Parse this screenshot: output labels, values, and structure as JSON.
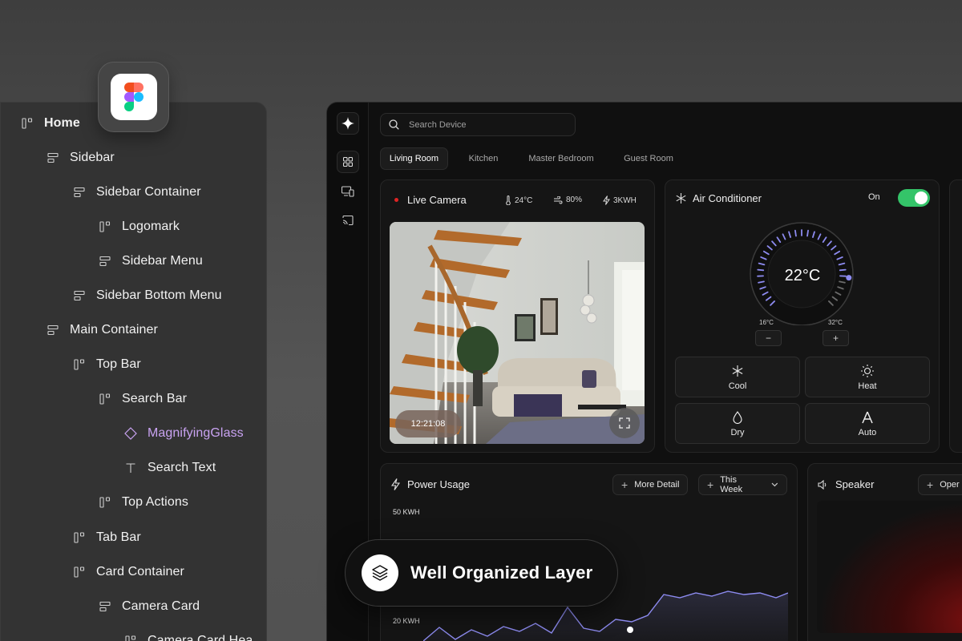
{
  "layers": [
    {
      "label": "Home",
      "icon": "frame-icon",
      "level": 0,
      "bold": true
    },
    {
      "label": "Sidebar",
      "icon": "auto-layout-icon",
      "level": 1
    },
    {
      "label": "Sidebar Container",
      "icon": "auto-layout-icon",
      "level": 2
    },
    {
      "label": "Logomark",
      "icon": "frame-icon",
      "level": 3
    },
    {
      "label": "Sidebar Menu",
      "icon": "auto-layout-icon",
      "level": 3
    },
    {
      "label": "Sidebar Bottom Menu",
      "icon": "auto-layout-icon",
      "level": 2
    },
    {
      "label": "Main Container",
      "icon": "auto-layout-icon",
      "level": 1
    },
    {
      "label": "Top Bar",
      "icon": "frame-icon",
      "level": 2
    },
    {
      "label": "Search Bar",
      "icon": "frame-icon",
      "level": 3
    },
    {
      "label": "MagnifyingGlass",
      "icon": "component-icon",
      "level": 4,
      "purple": true
    },
    {
      "label": "Search Text",
      "icon": "text-icon",
      "level": 4
    },
    {
      "label": "Top Actions",
      "icon": "frame-icon",
      "level": 3
    },
    {
      "label": "Tab Bar",
      "icon": "frame-icon",
      "level": 2
    },
    {
      "label": "Card Container",
      "icon": "frame-icon",
      "level": 2
    },
    {
      "label": "Camera Card",
      "icon": "auto-layout-icon",
      "level": 3
    },
    {
      "label": "Camera Card Hea",
      "icon": "frame-icon",
      "level": 4
    }
  ],
  "search": {
    "placeholder": "Search Device"
  },
  "tabs": [
    "Living Room",
    "Kitchen",
    "Master Bedroom",
    "Guest Room"
  ],
  "camera": {
    "title": "Live Camera",
    "temperature": "24°C",
    "humidity": "80%",
    "power": "3KWH",
    "timestamp": "12:21:08"
  },
  "ac": {
    "title": "Air Conditioner",
    "status": "On",
    "temperature": "22°C",
    "min_label": "16°C",
    "max_label": "32°C",
    "minus": "−",
    "plus": "+",
    "modes": [
      "Cool",
      "Heat",
      "Dry",
      "Auto"
    ]
  },
  "power": {
    "title": "Power Usage",
    "more_detail": "More Detail",
    "period": "This Week",
    "y_top": "50 KWH",
    "y_low": "20 KWH"
  },
  "speaker": {
    "title": "Speaker",
    "action": "Oper"
  },
  "badge": {
    "text": "Well Organized Layer"
  },
  "colors": {
    "accent_purple": "#c9a3f2",
    "toggle_green": "#34c469",
    "gauge_blue": "#8d8bf0"
  }
}
